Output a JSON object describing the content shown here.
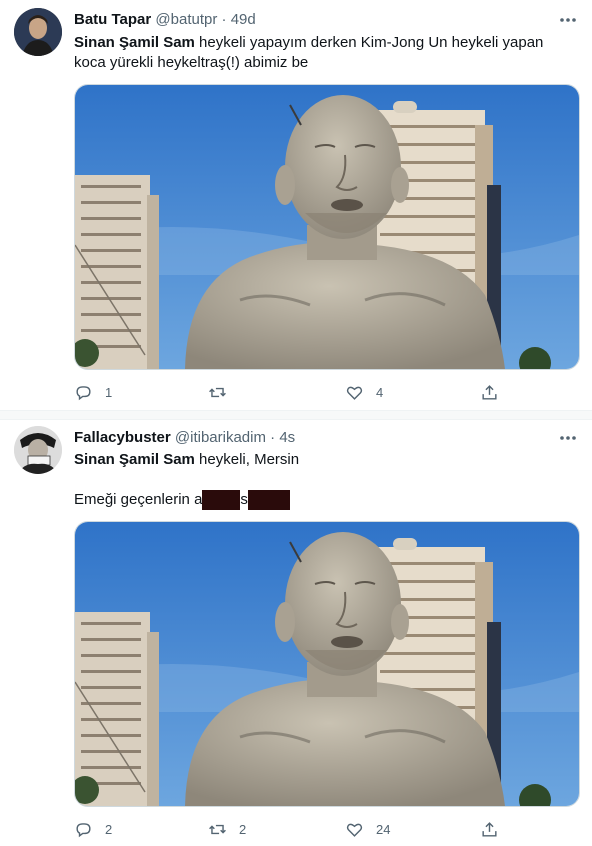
{
  "tweets": [
    {
      "author_name": "Batu Tapar",
      "handle": "@batutpr",
      "separator": "·",
      "time": "49d",
      "text_bold": "Sinan Şamil Sam",
      "text_rest": " heykeli yapayım derken Kim-Jong Un heykeli yapan koca yürekli heykeltraş(!) abimiz be",
      "replies": "1",
      "retweets": "",
      "likes": "4",
      "image_alt": "statue photo"
    },
    {
      "author_name": "Fallacybuster",
      "handle": "@itibarikadim",
      "separator": "·",
      "time": "4s",
      "text_bold": "Sinan Şamil Sam",
      "text_rest": " heykeli, Mersin",
      "text_line2_a": "Emeği geçenlerin a",
      "text_line2_b": "s",
      "replies": "2",
      "retweets": "2",
      "likes": "24",
      "image_alt": "statue photo"
    }
  ],
  "icons": {
    "more": "more-horizontal-icon",
    "reply": "reply-icon",
    "retweet": "retweet-icon",
    "like": "heart-icon",
    "share": "share-icon"
  },
  "colors": {
    "text": "#0f1419",
    "secondary": "#536471",
    "sky": "#3d7fd0",
    "redaction": "#2a0b0b"
  }
}
